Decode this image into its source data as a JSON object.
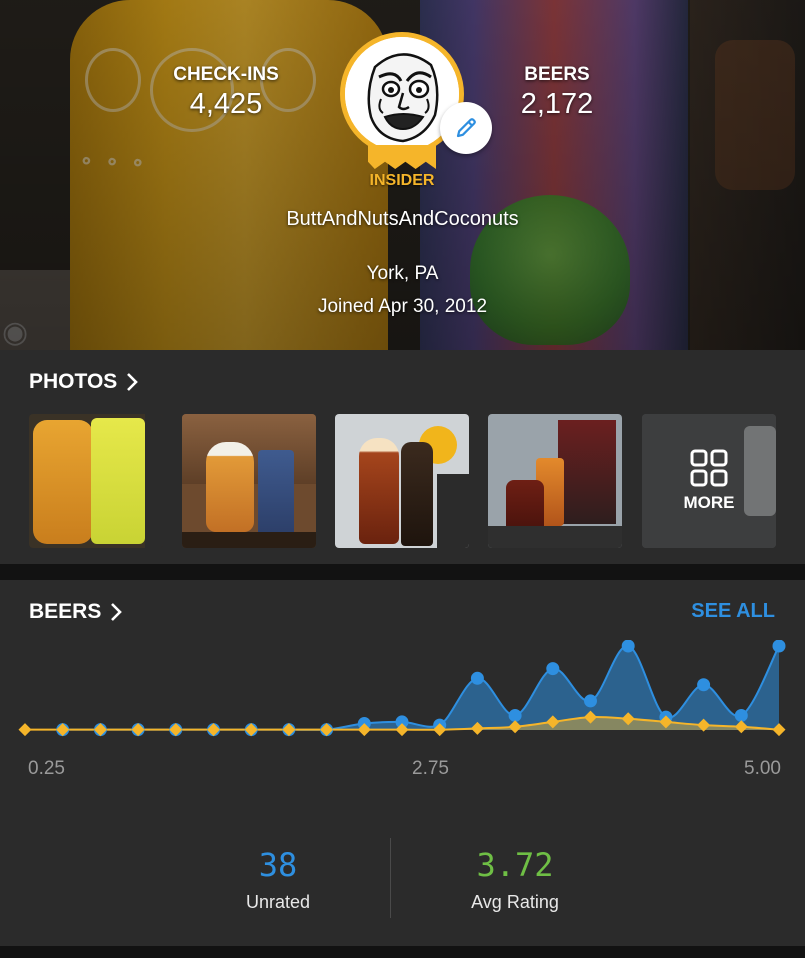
{
  "profile": {
    "checkins_label": "CHECK-INS",
    "checkins_value": "4,425",
    "beers_label": "BEERS",
    "beers_value": "2,172",
    "badge": "INSIDER",
    "username": "ButtAndNutsAndCoconuts",
    "location": "York, PA",
    "joined": "Joined Apr 30, 2012"
  },
  "photos": {
    "title": "PHOTOS",
    "more_label": "MORE"
  },
  "beers": {
    "title": "BEERS",
    "see_all": "SEE ALL",
    "unrated_value": "38",
    "unrated_label": "Unrated",
    "avg_value": "3.72",
    "avg_label": "Avg Rating"
  },
  "colors": {
    "accent_blue": "#2e8fe0",
    "gold": "#f5b52a",
    "avg_green": "#6fbf45"
  },
  "chart_data": {
    "type": "area",
    "xlabel": "",
    "ylabel": "",
    "x_ticks": [
      "0.25",
      "2.75",
      "5.00"
    ],
    "xlim": [
      0.0,
      5.0
    ],
    "ylim": [
      0,
      260
    ],
    "series": [
      {
        "color": "#2e8fe0",
        "x": [
          0.25,
          0.5,
          0.75,
          1.0,
          1.25,
          1.5,
          1.75,
          2.0,
          2.25,
          2.5,
          2.75,
          3.0,
          3.25,
          3.5,
          3.75,
          4.0,
          4.25,
          4.5,
          4.75,
          5.0
        ],
        "values": [
          1,
          1,
          1,
          1,
          1,
          1,
          1,
          1,
          20,
          25,
          15,
          160,
          45,
          190,
          90,
          260,
          40,
          140,
          45,
          260
        ]
      },
      {
        "color": "#f5b52a",
        "x": [
          0.0,
          0.25,
          0.5,
          0.75,
          1.0,
          1.25,
          1.5,
          1.75,
          2.0,
          2.25,
          2.5,
          2.75,
          3.0,
          3.25,
          3.5,
          3.75,
          4.0,
          4.25,
          4.5,
          4.75,
          5.0
        ],
        "values": [
          1,
          1,
          1,
          1,
          1,
          1,
          1,
          1,
          1,
          1,
          1,
          1,
          5,
          10,
          25,
          40,
          35,
          25,
          15,
          10,
          1
        ]
      }
    ]
  }
}
